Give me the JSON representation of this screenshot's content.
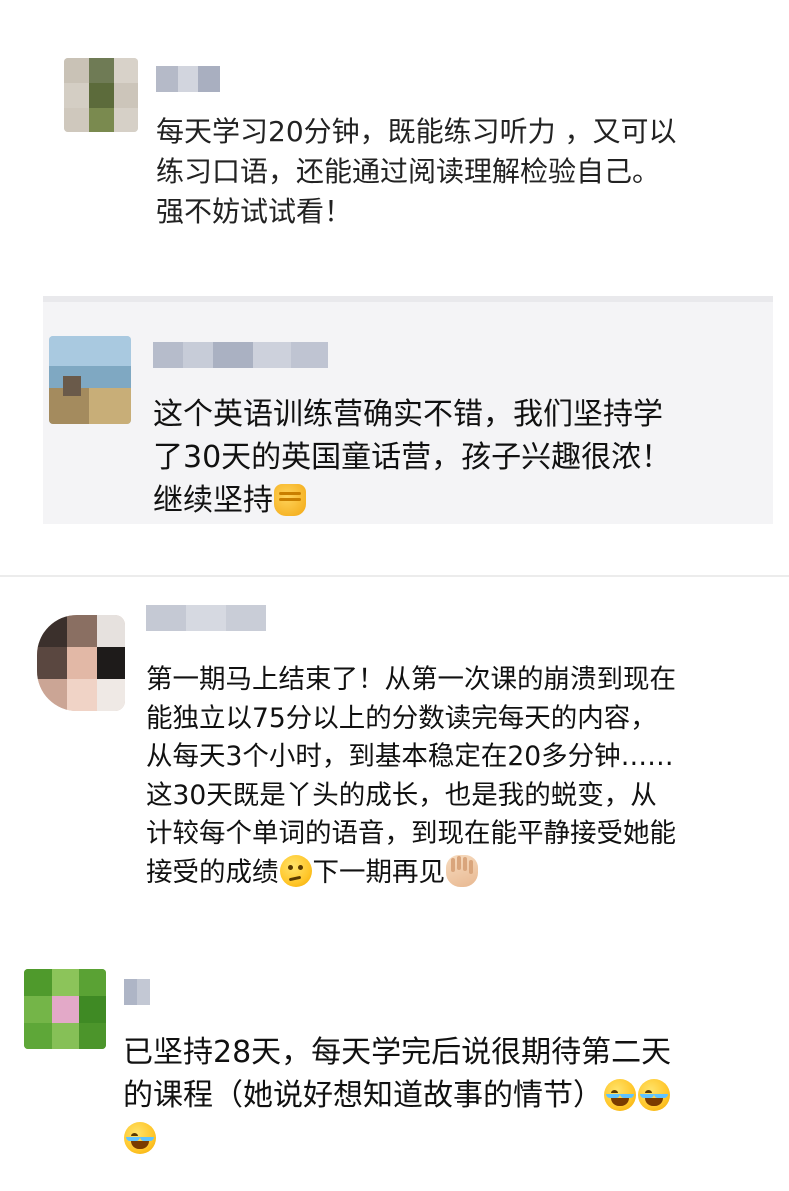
{
  "comments": [
    {
      "id": "c1",
      "text": "每天学习20分钟，既能练习听力 ，又可以\n练习口语，还能通过阅读理解检验自己。\n强不妨试试看！"
    },
    {
      "id": "c2",
      "text_before": "这个英语训练营确实不错，我们坚持学\n了30天的英国童话营，孩子兴趣很浓！\n继续坚持",
      "emoji_end": "fist-emoji"
    },
    {
      "id": "c3",
      "text_before": "第一期马上结束了！从第一次课的崩溃到现在\n能独立以75分以上的分数读完每天的内容，\n从每天3个小时，到基本稳定在20多分钟……\n这30天既是丫头的成长，也是我的蜕变，从\n计较每个单词的语音，到现在能平静接受她能\n接受的成绩",
      "emoji_mid": "thinking-emoji",
      "text_after": "下一期再见",
      "emoji_end": "waving-hand-emoji"
    },
    {
      "id": "c4",
      "text_before": "已坚持28天，每天学完后说很期待第二天\n的课程（她说好想知道故事的情节）",
      "emoji_end": [
        "tears-of-joy-emoji",
        "tears-of-joy-emoji",
        "tears-of-joy-emoji"
      ]
    }
  ],
  "colors": {
    "background": "#ffffff",
    "quoted_card": "#f4f4f6",
    "divider": "#ececec",
    "text": "#111111"
  }
}
